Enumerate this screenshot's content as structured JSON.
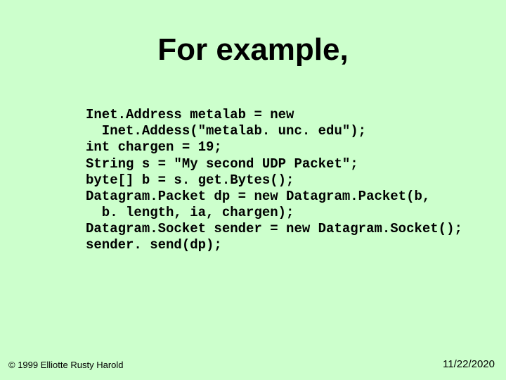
{
  "title": "For example,",
  "code": "Inet.Address metalab = new\n  Inet.Addess(\"metalab. unc. edu\");\nint chargen = 19;\nString s = \"My second UDP Packet\";\nbyte[] b = s. get.Bytes();\nDatagram.Packet dp = new Datagram.Packet(b,\n  b. length, ia, chargen);\nDatagram.Socket sender = new Datagram.Socket();\nsender. send(dp);",
  "copyright": "© 1999 Elliotte Rusty Harold",
  "date": "11/22/2020"
}
